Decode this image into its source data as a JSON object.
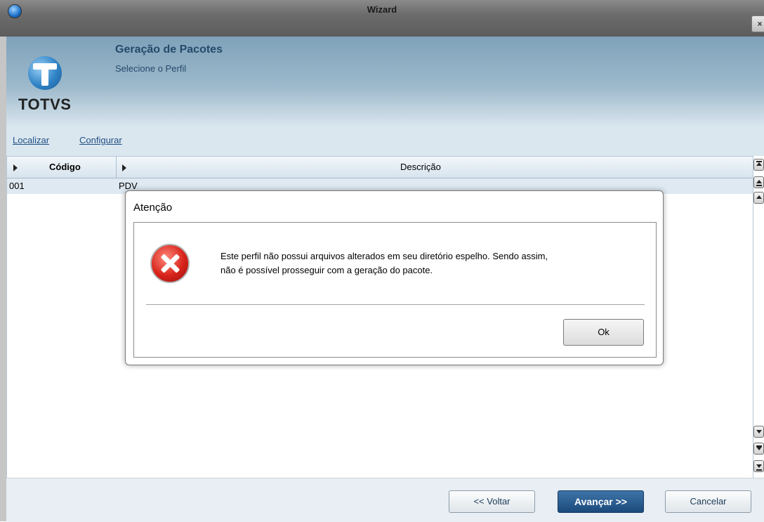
{
  "window": {
    "title": "Wizard",
    "close_label": "×"
  },
  "header": {
    "logo_text": "TOTVS",
    "title": "Geração de Pacotes",
    "subtitle": "Selecione o Perfil"
  },
  "links": {
    "localizar": "Localizar",
    "configurar": "Configurar"
  },
  "grid": {
    "columns": [
      "Código",
      "Descrição"
    ],
    "rows": [
      {
        "codigo": "001",
        "descricao": "PDV"
      }
    ]
  },
  "footer": {
    "back": "<< Voltar",
    "next": "Avançar >>",
    "cancel": "Cancelar"
  },
  "dialog": {
    "title": "Atenção",
    "message_line1": "Este perfil não possui arquivos alterados em seu diretório espelho. Sendo assim,",
    "message_line2": "não é possível prosseguir com a geração do pacote.",
    "ok_label": "Ok"
  }
}
